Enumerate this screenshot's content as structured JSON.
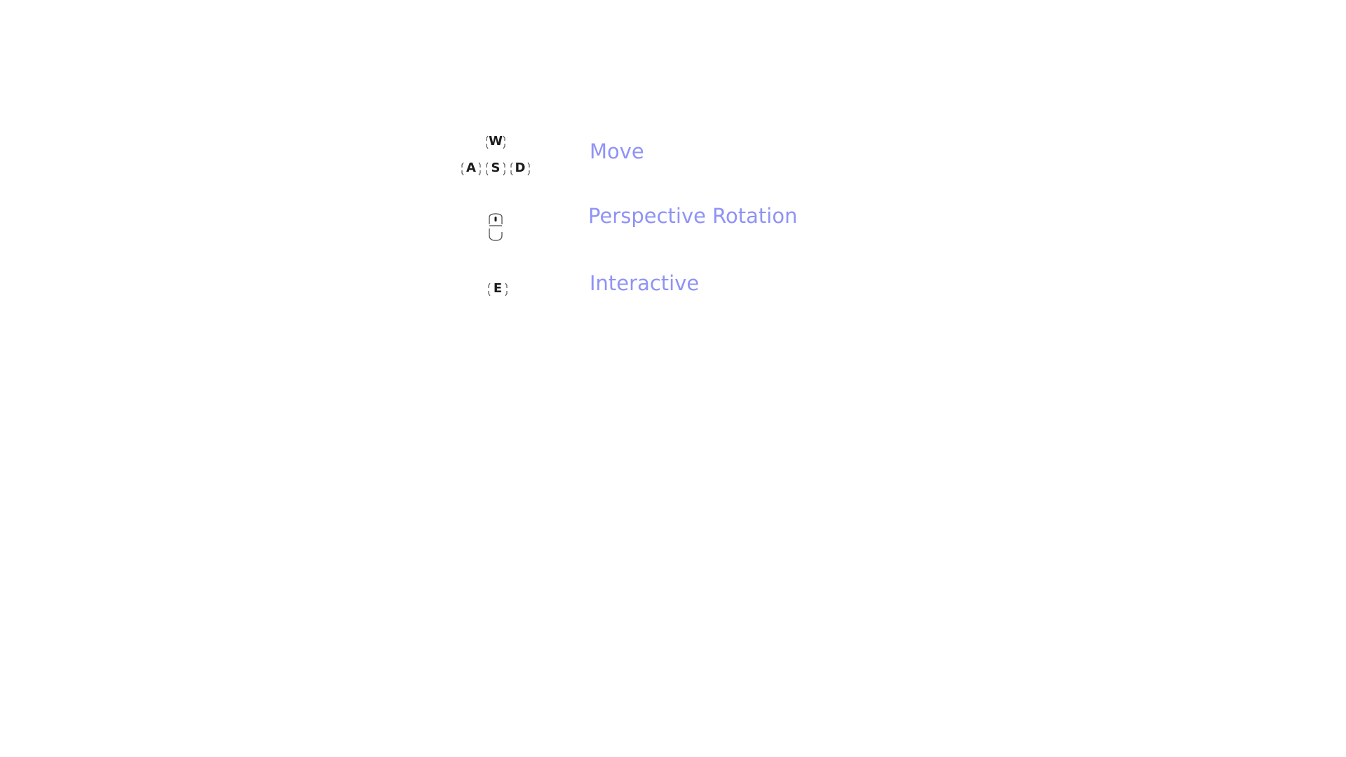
{
  "controls": {
    "move": {
      "keys": [
        "W",
        "A",
        "S",
        "D"
      ],
      "label": "Move"
    },
    "rotation": {
      "icon": "mouse-icon",
      "label": "Perspective Rotation"
    },
    "interact": {
      "keys": [
        "E"
      ],
      "label": "Interactive"
    }
  },
  "colors": {
    "label": "#8f93f5",
    "key_text": "#1c1c1c",
    "key_frame": "#555555",
    "background": "#ffffff"
  }
}
